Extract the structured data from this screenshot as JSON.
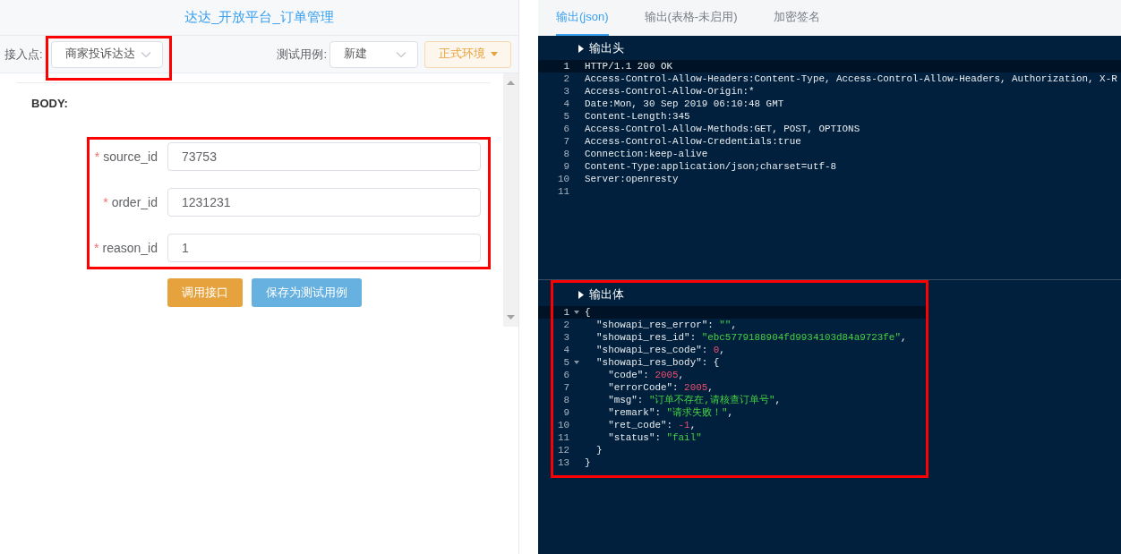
{
  "left_panel": {
    "title": "达达_开放平台_订单管理",
    "toolbar": {
      "entry_label": "接入点:",
      "entry_select": {
        "value": "商家投诉达达",
        "highlighted": true
      },
      "case_label": "测试用例:",
      "case_select": {
        "value": "新建"
      },
      "env_button": "正式环境"
    },
    "section_label": "BODY:",
    "fields_highlighted": true,
    "fields": [
      {
        "label": "source_id",
        "required_mark": "*",
        "value": "73753"
      },
      {
        "label": "order_id",
        "required_mark": "*",
        "value": "1231231"
      },
      {
        "label": "reason_id",
        "required_mark": "*",
        "value": "1"
      }
    ],
    "buttons": [
      {
        "label": "调用接口",
        "kind": "primary"
      },
      {
        "label": "保存为测试用例",
        "kind": "secondary"
      }
    ]
  },
  "right_panel": {
    "tabs": [
      {
        "label": "输出(json)",
        "selected": true
      },
      {
        "label": "输出(表格-未启用)",
        "selected": false
      },
      {
        "label": "加密签名",
        "selected": false
      }
    ],
    "output_header": {
      "title": "输出头",
      "lines": [
        {
          "number": "1",
          "active": true,
          "fold": false,
          "tokens": [
            {
              "kind": "plain",
              "text": "HTTP/1.1 200 OK"
            }
          ]
        },
        {
          "number": "2",
          "active": false,
          "fold": false,
          "tokens": [
            {
              "kind": "plain",
              "text": "Access-Control-Allow-Headers:Content-Type, Access-Control-Allow-Headers, Authorization, X-R"
            }
          ]
        },
        {
          "number": "3",
          "active": false,
          "fold": false,
          "tokens": [
            {
              "kind": "plain",
              "text": "Access-Control-Allow-Origin:*"
            }
          ]
        },
        {
          "number": "4",
          "active": false,
          "fold": false,
          "tokens": [
            {
              "kind": "plain",
              "text": "Date:Mon, 30 Sep 2019 06:10:48 GMT"
            }
          ]
        },
        {
          "number": "5",
          "active": false,
          "fold": false,
          "tokens": [
            {
              "kind": "plain",
              "text": "Content-Length:345"
            }
          ]
        },
        {
          "number": "6",
          "active": false,
          "fold": false,
          "tokens": [
            {
              "kind": "plain",
              "text": "Access-Control-Allow-Methods:GET, POST, OPTIONS"
            }
          ]
        },
        {
          "number": "7",
          "active": false,
          "fold": false,
          "tokens": [
            {
              "kind": "plain",
              "text": "Access-Control-Allow-Credentials:true"
            }
          ]
        },
        {
          "number": "8",
          "active": false,
          "fold": false,
          "tokens": [
            {
              "kind": "plain",
              "text": "Connection:keep-alive"
            }
          ]
        },
        {
          "number": "9",
          "active": false,
          "fold": false,
          "tokens": [
            {
              "kind": "plain",
              "text": "Content-Type:application/json;charset=utf-8"
            }
          ]
        },
        {
          "number": "10",
          "active": false,
          "fold": false,
          "tokens": [
            {
              "kind": "plain",
              "text": "Server:openresty"
            }
          ]
        },
        {
          "number": "11",
          "active": false,
          "fold": false
        }
      ]
    },
    "output_body": {
      "title": "输出体",
      "highlighted": true,
      "lines": [
        {
          "number": "1",
          "active": true,
          "fold": true,
          "tokens": [
            {
              "kind": "plain",
              "text": "{"
            }
          ]
        },
        {
          "number": "2",
          "active": false,
          "fold": false,
          "tokens": [
            {
              "kind": "plain",
              "text": "  \"showapi_res_error\": "
            },
            {
              "kind": "string",
              "text": "\"\""
            },
            {
              "kind": "plain",
              "text": ","
            }
          ]
        },
        {
          "number": "3",
          "active": false,
          "fold": false,
          "tokens": [
            {
              "kind": "plain",
              "text": "  \"showapi_res_id\": "
            },
            {
              "kind": "string",
              "text": "\"ebc5779188904fd9934103d84a9723fe\""
            },
            {
              "kind": "plain",
              "text": ","
            }
          ]
        },
        {
          "number": "4",
          "active": false,
          "fold": false,
          "tokens": [
            {
              "kind": "plain",
              "text": "  \"showapi_res_code\": "
            },
            {
              "kind": "number",
              "text": "0"
            },
            {
              "kind": "plain",
              "text": ","
            }
          ]
        },
        {
          "number": "5",
          "active": false,
          "fold": true,
          "tokens": [
            {
              "kind": "plain",
              "text": "  \"showapi_res_body\": {"
            }
          ]
        },
        {
          "number": "6",
          "active": false,
          "fold": false,
          "tokens": [
            {
              "kind": "plain",
              "text": "    \"code\": "
            },
            {
              "kind": "number",
              "text": "2005"
            },
            {
              "kind": "plain",
              "text": ","
            }
          ]
        },
        {
          "number": "7",
          "active": false,
          "fold": false,
          "tokens": [
            {
              "kind": "plain",
              "text": "    \"errorCode\": "
            },
            {
              "kind": "number",
              "text": "2005"
            },
            {
              "kind": "plain",
              "text": ","
            }
          ]
        },
        {
          "number": "8",
          "active": false,
          "fold": false,
          "tokens": [
            {
              "kind": "plain",
              "text": "    \"msg\": "
            },
            {
              "kind": "string",
              "text": "\"订单不存在,请核查订单号\""
            },
            {
              "kind": "plain",
              "text": ","
            }
          ]
        },
        {
          "number": "9",
          "active": false,
          "fold": false,
          "tokens": [
            {
              "kind": "plain",
              "text": "    \"remark\": "
            },
            {
              "kind": "string",
              "text": "\"请求失败！\""
            },
            {
              "kind": "plain",
              "text": ","
            }
          ]
        },
        {
          "number": "10",
          "active": false,
          "fold": false,
          "tokens": [
            {
              "kind": "plain",
              "text": "    \"ret_code\": "
            },
            {
              "kind": "number",
              "text": "-1"
            },
            {
              "kind": "plain",
              "text": ","
            }
          ]
        },
        {
          "number": "11",
          "active": false,
          "fold": false,
          "tokens": [
            {
              "kind": "plain",
              "text": "    \"status\": "
            },
            {
              "kind": "string",
              "text": "\"fail\""
            }
          ]
        },
        {
          "number": "12",
          "active": false,
          "fold": false,
          "tokens": [
            {
              "kind": "plain",
              "text": "  }"
            }
          ]
        },
        {
          "number": "13",
          "active": false,
          "fold": false,
          "tokens": [
            {
              "kind": "plain",
              "text": "}"
            }
          ]
        }
      ]
    }
  }
}
